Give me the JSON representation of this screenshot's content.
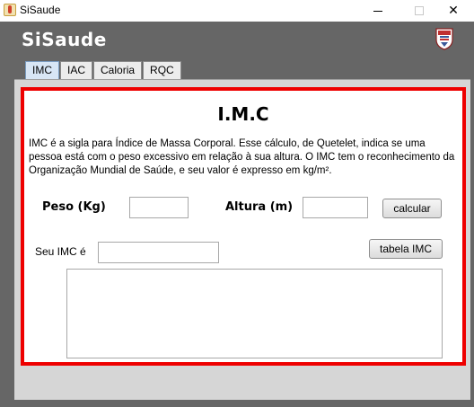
{
  "window": {
    "title": "SiSaude",
    "minimize": "—",
    "maximize": "☐",
    "close": "✕"
  },
  "app": {
    "brand": "SiSaude",
    "logo_icon": "university-crest-icon"
  },
  "tabs": [
    {
      "label": "IMC",
      "active": true
    },
    {
      "label": "IAC",
      "active": false
    },
    {
      "label": "Caloria",
      "active": false
    },
    {
      "label": "RQC",
      "active": false
    }
  ],
  "imc": {
    "title": "I.M.C",
    "description": "IMC é a sigla para Índice de Massa Corporal. Esse cálculo, de Quetelet, indica se uma pessoa está com o peso excessivo em relação à sua altura. O IMC tem o reconhecimento da Organização Mundial de Saúde, e seu valor é expresso em kg/m².",
    "peso_label": "Peso (Kg)",
    "peso_value": "",
    "altura_label": "Altura (m)",
    "altura_value": "",
    "calcular_label": "calcular",
    "seu_imc_label": "Seu IMC é",
    "seu_imc_value": "",
    "tabela_label": "tabela IMC",
    "result_text": ""
  },
  "colors": {
    "frame": "#666666",
    "highlight_border": "#ee0000",
    "active_tab": "#d8e6f5"
  }
}
